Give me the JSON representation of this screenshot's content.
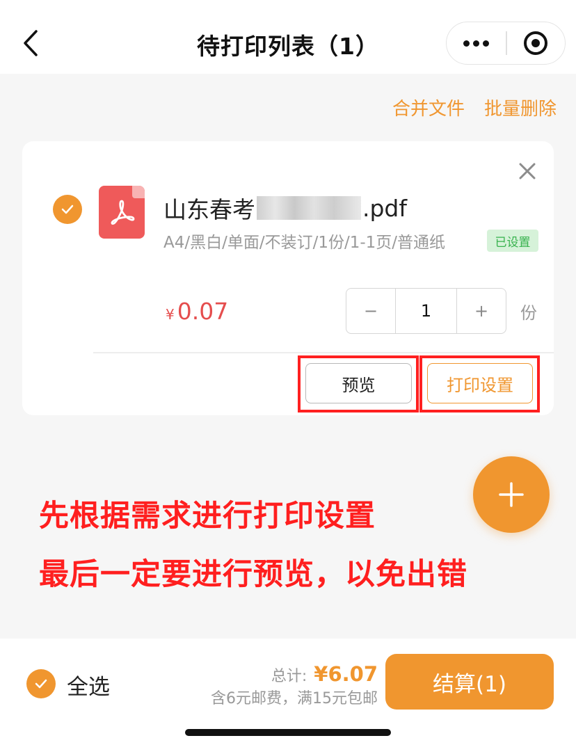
{
  "nav": {
    "title": "待打印列表（1）",
    "back_icon": "chevron-left-icon",
    "more_icon": "more-dots-icon",
    "close_icon": "target-close-icon"
  },
  "actions": {
    "merge": "合并文件",
    "batch_delete": "批量删除"
  },
  "file": {
    "name_prefix": "山东春考",
    "name_suffix": ".pdf",
    "spec": "A4/黑白/单面/不装订/1份/1-1页/普通纸",
    "badge": "已设置",
    "currency": "¥",
    "price": "0.07",
    "quantity": "1",
    "minus": "−",
    "plus": "+",
    "unit": "份",
    "preview_label": "预览",
    "settings_label": "打印设置"
  },
  "annotation": {
    "line1": "先根据需求进行打印设置",
    "line2": "最后一定要进行预览，以免出错"
  },
  "footer": {
    "select_all": "全选",
    "total_label": "总计:",
    "total_price": "¥6.07",
    "postage_note": "含6元邮费，满15元包邮",
    "checkout_label": "结算(1)"
  },
  "colors": {
    "accent": "#f0962f",
    "price_red": "#e54d4d",
    "annotation_red": "#ff1f1f",
    "badge_green": "#37b24d"
  }
}
